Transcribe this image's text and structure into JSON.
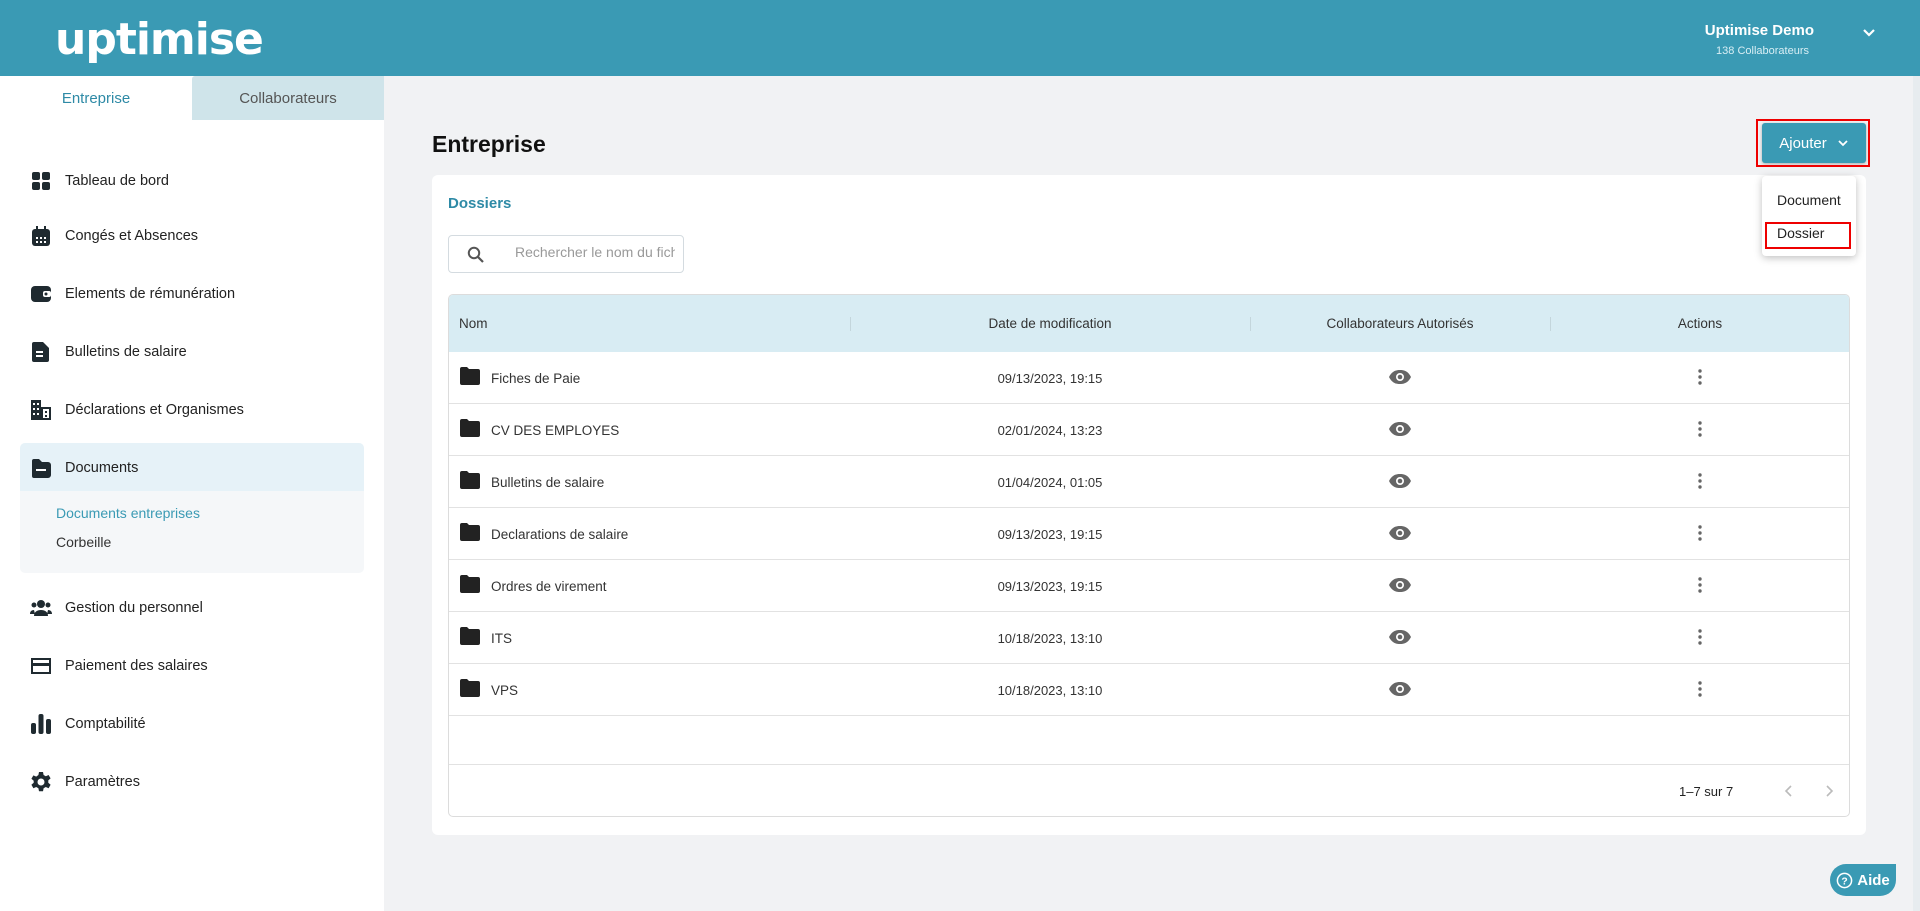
{
  "header": {
    "logo": "uptimise",
    "company": "Uptimise Demo",
    "collaborators": "138 Collaborateurs"
  },
  "sidebar": {
    "tabs": [
      "Entreprise",
      "Collaborateurs"
    ],
    "items": [
      {
        "label": "Tableau de bord",
        "icon": "dashboard-icon"
      },
      {
        "label": "Congés et Absences",
        "icon": "calendar-icon"
      },
      {
        "label": "Elements de rémunération",
        "icon": "wallet-icon"
      },
      {
        "label": "Bulletins de salaire",
        "icon": "document-icon"
      },
      {
        "label": "Déclarations et Organismes",
        "icon": "building-icon"
      },
      {
        "label": "Documents",
        "icon": "folder-icon"
      },
      {
        "label": "Gestion du personnel",
        "icon": "people-icon"
      },
      {
        "label": "Paiement des salaires",
        "icon": "credit-card-icon"
      },
      {
        "label": "Comptabilité",
        "icon": "bar-chart-icon"
      },
      {
        "label": "Paramètres",
        "icon": "gear-icon"
      }
    ],
    "documents_sub": [
      "Documents entreprises",
      "Corbeille"
    ]
  },
  "main": {
    "title": "Entreprise",
    "add_button": "Ajouter",
    "add_menu": [
      "Document",
      "Dossier"
    ],
    "section": "Dossiers",
    "search_placeholder": "Rechercher le nom du fichier",
    "columns": [
      "Nom",
      "Date de modification",
      "Collaborateurs Autorisés",
      "Actions"
    ],
    "rows": [
      {
        "name": "Fiches de Paie",
        "date": "09/13/2023, 19:15"
      },
      {
        "name": "CV DES EMPLOYES",
        "date": "02/01/2024, 13:23"
      },
      {
        "name": "Bulletins de salaire",
        "date": "01/04/2024, 01:05"
      },
      {
        "name": "Declarations de salaire",
        "date": "09/13/2023, 19:15"
      },
      {
        "name": "Ordres de virement",
        "date": "09/13/2023, 19:15"
      },
      {
        "name": "ITS",
        "date": "10/18/2023, 13:10"
      },
      {
        "name": "VPS",
        "date": "10/18/2023, 13:10"
      }
    ],
    "pagination": "1–7 sur 7",
    "help": "Aide"
  },
  "colors": {
    "brand": "#3a9ab4",
    "accent_text": "#2e8aa6",
    "table_header": "#d8ecf3"
  }
}
